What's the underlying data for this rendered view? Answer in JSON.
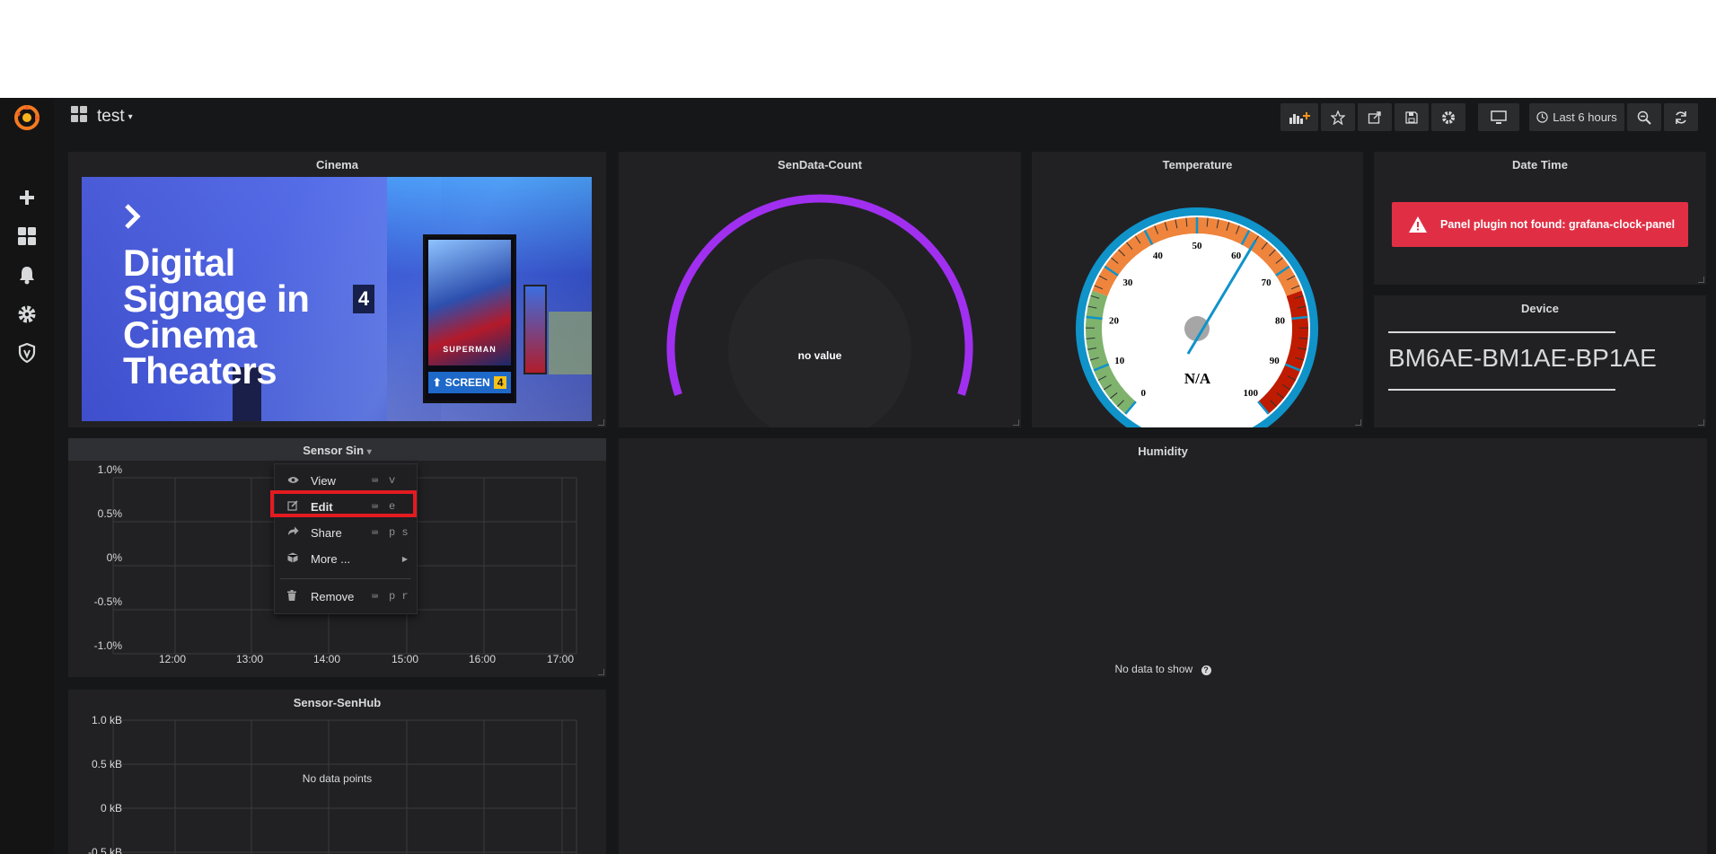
{
  "dashboard": {
    "title": "test"
  },
  "toolbar": {
    "time_range": "Last 6 hours"
  },
  "panels": {
    "cinema": {
      "title": "Cinema",
      "image_text": [
        "Digital",
        "Signage in",
        "Cinema",
        "Theaters"
      ],
      "poster_title": "SUPERMAN",
      "screen_label": "SCREEN",
      "screen_number": "4",
      "wall_number": "4"
    },
    "sendata": {
      "title": "SenData-Count",
      "value_text": "no value"
    },
    "temperature": {
      "title": "Temperature",
      "value_text": "N/A",
      "dial_labels": [
        "0",
        "10",
        "20",
        "30",
        "40",
        "50",
        "60",
        "70",
        "80",
        "90",
        "100"
      ]
    },
    "datetime": {
      "title": "Date Time",
      "error": "Panel plugin not found: grafana-clock-panel"
    },
    "device": {
      "title": "Device",
      "value": "BM6AE-BM1AE-BP1AE"
    },
    "sensor_sin": {
      "title": "Sensor Sin",
      "y_ticks": [
        "1.0%",
        "0.5%",
        "0%",
        "-0.5%",
        "-1.0%"
      ],
      "x_ticks": [
        "12:00",
        "13:00",
        "14:00",
        "15:00",
        "16:00",
        "17:00"
      ]
    },
    "humidity": {
      "title": "Humidity",
      "empty_text": "No data to show"
    },
    "sensor_senhub": {
      "title": "Sensor-SenHub",
      "y_ticks": [
        "1.0 kB",
        "0.5 kB",
        "0 kB",
        "-0.5 kB"
      ],
      "empty_text": "No data points"
    }
  },
  "context_menu": {
    "items": [
      {
        "label": "View",
        "key": "v"
      },
      {
        "label": "Edit",
        "key": "e"
      },
      {
        "label": "Share",
        "key": "p s"
      },
      {
        "label": "More ...",
        "key": ""
      },
      {
        "label": "Remove",
        "key": "p r"
      }
    ]
  },
  "colors": {
    "accent": "#e21b21",
    "error_bg": "#e02f44",
    "gauge_arc": "#a12ff0",
    "dial_ring": "#0f93c9"
  },
  "icons": [
    "grafana-logo-icon",
    "plus-icon",
    "dashboards-icon",
    "bell-icon",
    "gear-icon",
    "shield-icon"
  ]
}
